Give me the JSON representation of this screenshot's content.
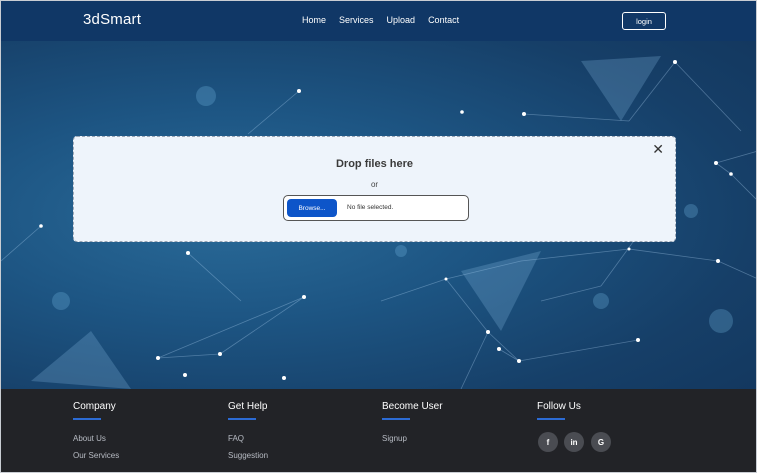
{
  "navbar": {
    "brand": "3dSmart",
    "links": [
      "Home",
      "Services",
      "Upload",
      "Contact"
    ],
    "login_label": "login"
  },
  "upload": {
    "title": "Drop files here",
    "or_text": "or",
    "browse_label": "Browse...",
    "file_status": "No file selected.",
    "close_glyph": "✕"
  },
  "footer": {
    "company": {
      "heading": "Company",
      "links": [
        "About Us",
        "Our Services"
      ]
    },
    "help": {
      "heading": "Get Help",
      "links": [
        "FAQ",
        "Suggestion"
      ]
    },
    "become": {
      "heading": "Become User",
      "links": [
        "Signup"
      ]
    },
    "follow": {
      "heading": "Follow Us",
      "icons": [
        "f",
        "in",
        "G"
      ]
    }
  },
  "colors": {
    "navbar_bg": "#103766",
    "browse_button": "#0d55c9",
    "footer_bg": "#222327",
    "accent_underline": "#2c6bd4"
  }
}
